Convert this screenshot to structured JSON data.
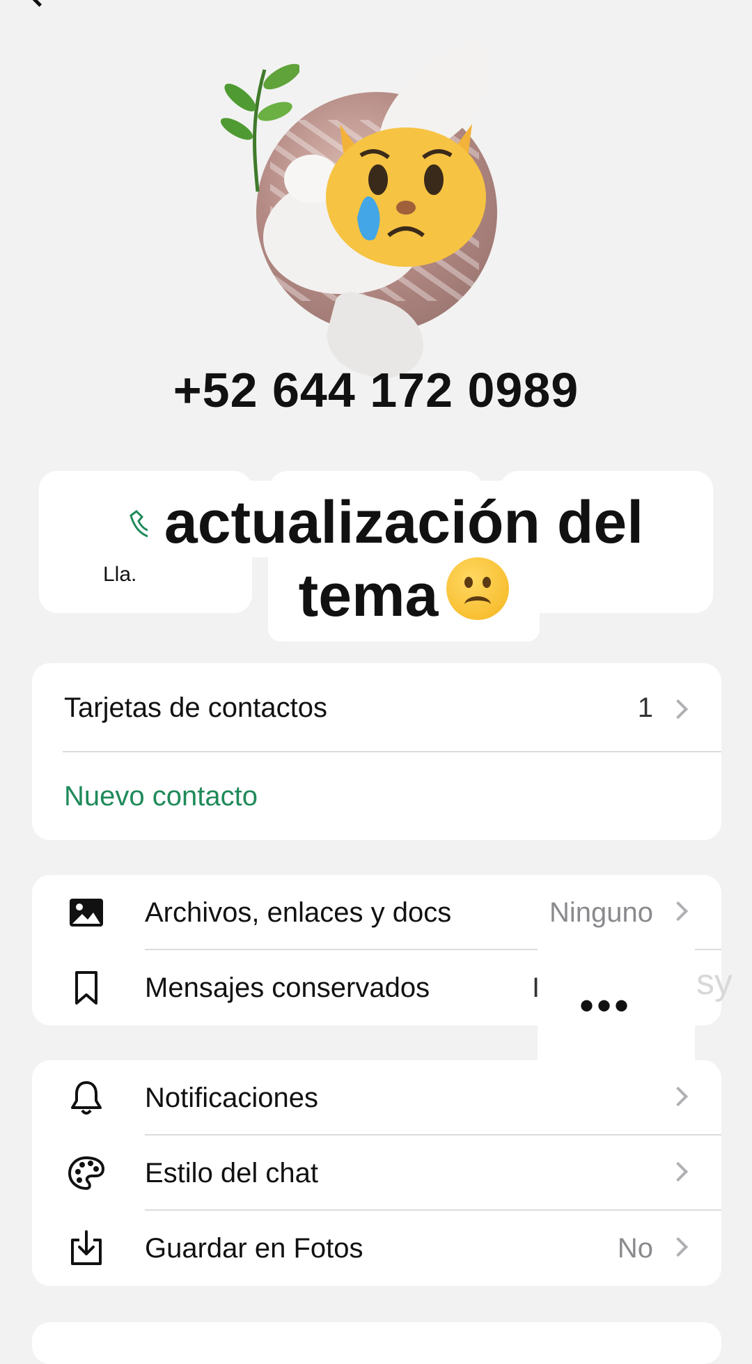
{
  "contact": {
    "phone": "+52 644 172 0989"
  },
  "actions": {
    "call_label": "Lla."
  },
  "caption": {
    "line1": "actualización del",
    "line2": "tema"
  },
  "contact_cards": {
    "label": "Tarjetas de contactos",
    "count": "1",
    "new_contact": "Nuevo contacto"
  },
  "media": {
    "files_label": "Archivos, enlaces y docs",
    "files_value": "Ninguno",
    "kept_label": "Mensajes conservados",
    "kept_value": "I",
    "more": "•••",
    "ghost": "sy"
  },
  "settings": {
    "notifications": "Notificaciones",
    "chat_style": "Estilo del chat",
    "save_photos": "Guardar en Fotos",
    "save_photos_value": "No"
  },
  "colors": {
    "accent": "#1f8a5a",
    "background": "#f2f2f2"
  }
}
